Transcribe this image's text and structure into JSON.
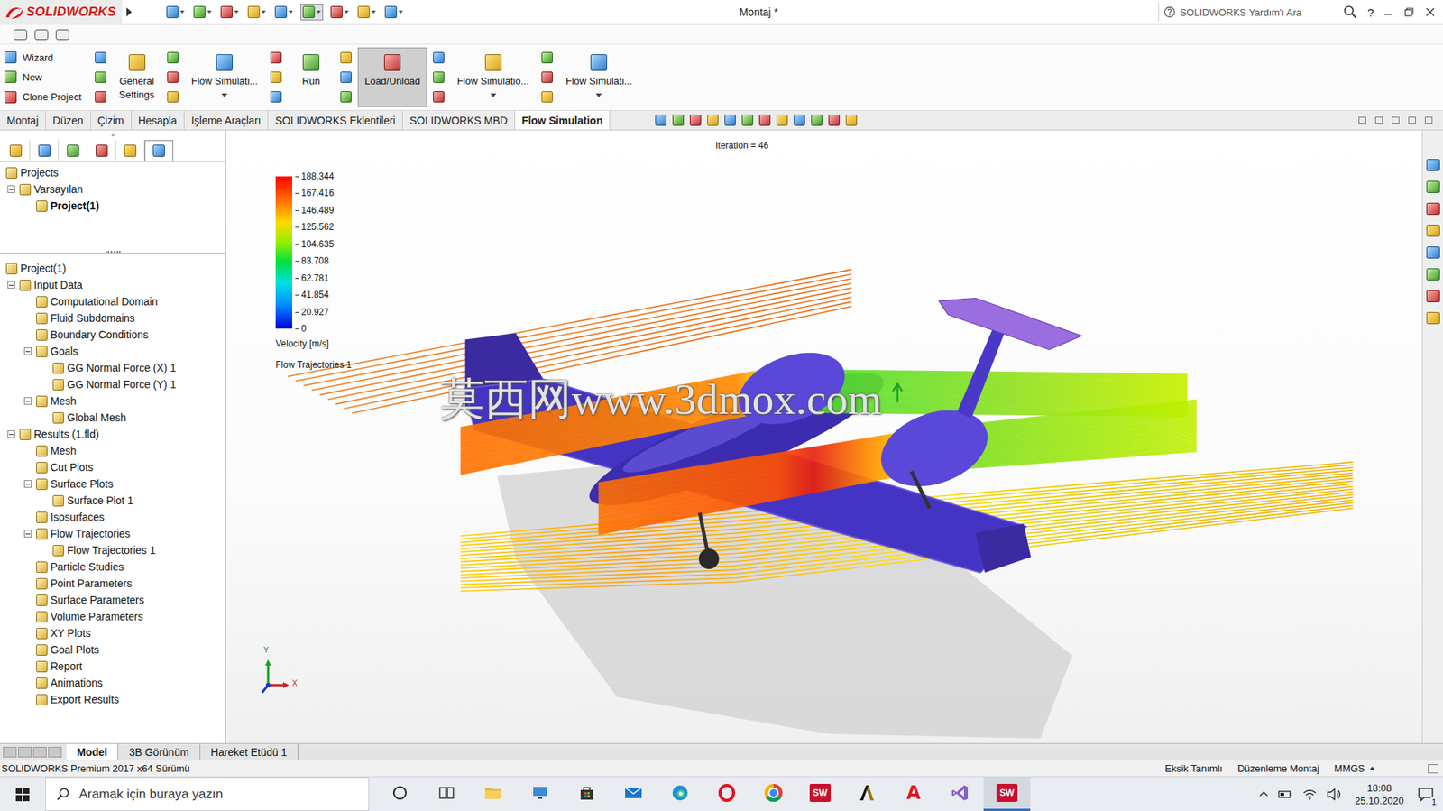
{
  "window": {
    "app": "SOLIDWORKS",
    "title": "Montaj *",
    "search_placeholder": "SOLIDWORKS Yardım'ı Ara",
    "help": "?"
  },
  "ribbon": {
    "small": [
      {
        "label": "Wizard"
      },
      {
        "label": "New"
      },
      {
        "label": "Clone Project"
      }
    ],
    "large": [
      {
        "lines": [
          "General",
          "Settings"
        ],
        "selected": false,
        "dropdown": false
      },
      {
        "lines": [
          "Flow Simulati..."
        ],
        "selected": false,
        "dropdown": true
      },
      {
        "lines": [
          "Run"
        ],
        "selected": false,
        "dropdown": false
      },
      {
        "lines": [
          "Load/Unload"
        ],
        "selected": true,
        "dropdown": false
      },
      {
        "lines": [
          "Flow Simulatio..."
        ],
        "selected": false,
        "dropdown": true
      },
      {
        "lines": [
          "Flow Simulati..."
        ],
        "selected": false,
        "dropdown": true
      }
    ]
  },
  "tabs": [
    {
      "label": "Montaj",
      "selected": false
    },
    {
      "label": "Düzen",
      "selected": false
    },
    {
      "label": "Çizim",
      "selected": false
    },
    {
      "label": "Hesapla",
      "selected": false
    },
    {
      "label": "İşleme Araçları",
      "selected": false
    },
    {
      "label": "SOLIDWORKS Eklentileri",
      "selected": false
    },
    {
      "label": "SOLIDWORKS MBD",
      "selected": false
    },
    {
      "label": "Flow Simulation",
      "selected": true
    }
  ],
  "panel_tabs": [
    {
      "selected": false
    },
    {
      "selected": false
    },
    {
      "selected": false
    },
    {
      "selected": false
    },
    {
      "selected": false
    },
    {
      "selected": true
    }
  ],
  "project_tree": [
    {
      "label": "Projects",
      "depth": 0,
      "kind": "root",
      "expanded": true,
      "active": false
    },
    {
      "label": "Varsayılan",
      "depth": 0,
      "kind": "branch",
      "expanded": true,
      "active": false
    },
    {
      "label": "Project(1)",
      "depth": 1,
      "kind": "leaf",
      "expanded": false,
      "active": true
    }
  ],
  "analysis_tree": [
    {
      "label": "Project(1)",
      "depth": 0,
      "kind": "root",
      "expanded": true,
      "active": false
    },
    {
      "label": "Input Data",
      "depth": 0,
      "kind": "branch",
      "expanded": true,
      "active": false
    },
    {
      "label": "Computational Domain",
      "depth": 1,
      "kind": "leaf",
      "expanded": false,
      "active": false
    },
    {
      "label": "Fluid Subdomains",
      "depth": 1,
      "kind": "leaf",
      "expanded": false,
      "active": false
    },
    {
      "label": "Boundary Conditions",
      "depth": 1,
      "kind": "leaf",
      "expanded": false,
      "active": false
    },
    {
      "label": "Goals",
      "depth": 1,
      "kind": "branch",
      "expanded": true,
      "active": false
    },
    {
      "label": "GG Normal Force (X) 1",
      "depth": 2,
      "kind": "leaf",
      "expanded": false,
      "active": false
    },
    {
      "label": "GG Normal Force (Y) 1",
      "depth": 2,
      "kind": "leaf",
      "expanded": false,
      "active": false
    },
    {
      "label": "Mesh",
      "depth": 1,
      "kind": "branch",
      "expanded": true,
      "active": false
    },
    {
      "label": "Global Mesh",
      "depth": 2,
      "kind": "leaf",
      "expanded": false,
      "active": false
    },
    {
      "label": "Results (1.fld)",
      "depth": 0,
      "kind": "branch",
      "expanded": true,
      "active": false
    },
    {
      "label": "Mesh",
      "depth": 1,
      "kind": "leaf",
      "expanded": false,
      "active": false
    },
    {
      "label": "Cut Plots",
      "depth": 1,
      "kind": "leaf",
      "expanded": false,
      "active": false
    },
    {
      "label": "Surface Plots",
      "depth": 1,
      "kind": "branch",
      "expanded": true,
      "active": false
    },
    {
      "label": "Surface Plot 1",
      "depth": 2,
      "kind": "leaf",
      "expanded": false,
      "active": false
    },
    {
      "label": "Isosurfaces",
      "depth": 1,
      "kind": "leaf",
      "expanded": false,
      "active": false
    },
    {
      "label": "Flow Trajectories",
      "depth": 1,
      "kind": "branch",
      "expanded": true,
      "active": false
    },
    {
      "label": "Flow Trajectories 1",
      "depth": 2,
      "kind": "leaf",
      "expanded": false,
      "active": false
    },
    {
      "label": "Particle Studies",
      "depth": 1,
      "kind": "leaf",
      "expanded": false,
      "active": false
    },
    {
      "label": "Point Parameters",
      "depth": 1,
      "kind": "leaf",
      "expanded": false,
      "active": false
    },
    {
      "label": "Surface Parameters",
      "depth": 1,
      "kind": "leaf",
      "expanded": false,
      "active": false
    },
    {
      "label": "Volume Parameters",
      "depth": 1,
      "kind": "leaf",
      "expanded": false,
      "active": false
    },
    {
      "label": "XY Plots",
      "depth": 1,
      "kind": "leaf",
      "expanded": false,
      "active": false
    },
    {
      "label": "Goal Plots",
      "depth": 1,
      "kind": "leaf",
      "expanded": false,
      "active": false
    },
    {
      "label": "Report",
      "depth": 1,
      "kind": "leaf",
      "expanded": false,
      "active": false
    },
    {
      "label": "Animations",
      "depth": 1,
      "kind": "leaf",
      "expanded": false,
      "active": false
    },
    {
      "label": "Export Results",
      "depth": 1,
      "kind": "leaf",
      "expanded": false,
      "active": false
    }
  ],
  "viewport": {
    "iteration": "Iteration = 46",
    "legend": {
      "values": [
        "188.344",
        "167.416",
        "146.489",
        "125.562",
        "104.635",
        "83.708",
        "62.781",
        "41.854",
        "20.927",
        "0"
      ],
      "unit": "Velocity [m/s]",
      "plot": "Flow Trajectories 1"
    },
    "watermark": "莫西网www.3dmox.com",
    "triad": {
      "x": "X",
      "y": "Y"
    }
  },
  "bottom_tabs": [
    {
      "label": "Model",
      "selected": true
    },
    {
      "label": "3B Görünüm",
      "selected": false
    },
    {
      "label": "Hareket Etüdü 1",
      "selected": false
    }
  ],
  "status_bar": {
    "version": "SOLIDWORKS Premium 2017 x64 Sürümü",
    "items": [
      "Eksik Tanımlı",
      "Düzenleme Montaj",
      "MMGS"
    ]
  },
  "taskbar": {
    "search_placeholder": "Aramak için buraya yazın",
    "time": "18:08",
    "date": "25.10.2020",
    "notifications": "1",
    "apps": [
      {
        "kind": "cortana",
        "active": false
      },
      {
        "kind": "taskview",
        "active": false
      },
      {
        "kind": "folder",
        "active": false
      },
      {
        "kind": "network",
        "active": false
      },
      {
        "kind": "store",
        "active": false
      },
      {
        "kind": "mail",
        "active": false
      },
      {
        "kind": "edge",
        "active": false
      },
      {
        "kind": "opera",
        "active": false
      },
      {
        "kind": "chrome",
        "active": false
      },
      {
        "kind": "sw",
        "glyph": "SW",
        "active": false
      },
      {
        "kind": "autodesk",
        "active": false
      },
      {
        "kind": "acrobat",
        "glyph": "A",
        "active": false
      },
      {
        "kind": "vs",
        "active": false
      },
      {
        "kind": "sw",
        "glyph": "SW",
        "active": true
      }
    ]
  }
}
